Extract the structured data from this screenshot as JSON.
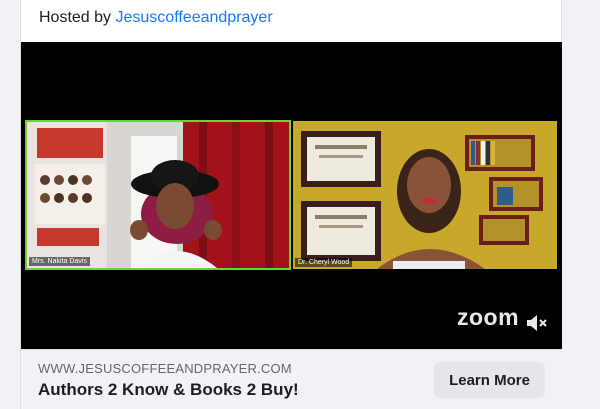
{
  "post": {
    "hosted_prefix": "Hosted by",
    "host_name": "Jesuscoffeeandprayer"
  },
  "video": {
    "participants": [
      {
        "name": "Mrs. Nakita Davis",
        "active_speaker": true
      },
      {
        "name": "Dr. Cheryl Wood",
        "active_speaker": false
      }
    ],
    "watermark": "zoom",
    "active_border_color": "#6ad03c"
  },
  "link_preview": {
    "domain": "WWW.JESUSCOFFEEANDPRAYER.COM",
    "title": "Authors 2 Know & Books 2 Buy!",
    "cta_label": "Learn More"
  },
  "colors": {
    "link": "#1877f2",
    "button_bg": "#e4e6eb",
    "footer_bg": "#f0f2f5"
  }
}
